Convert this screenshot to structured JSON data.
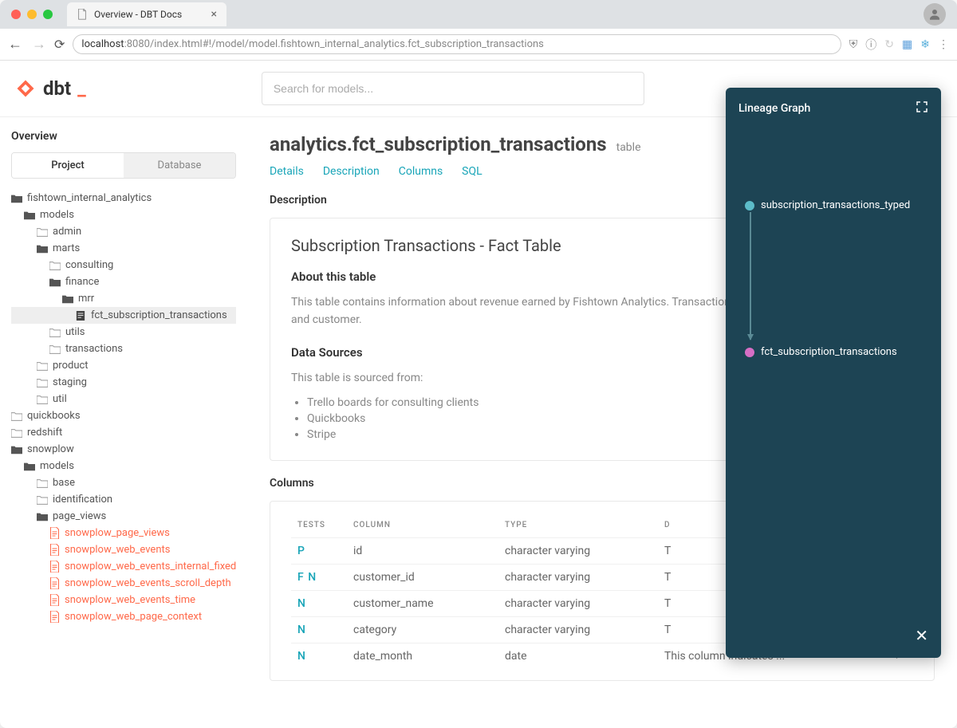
{
  "browser": {
    "tab_title": "Overview - DBT Docs",
    "url_host": "localhost",
    "url_port": ":8080",
    "url_path": "/index.html#!/model/model.fishtown_internal_analytics.fct_subscription_transactions"
  },
  "header": {
    "brand": "dbt",
    "search_placeholder": "Search for models..."
  },
  "sidebar": {
    "overview_label": "Overview",
    "tabs": {
      "project": "Project",
      "database": "Database"
    },
    "tree": [
      {
        "indent": 0,
        "icon": "folder",
        "label": "fishtown_internal_analytics",
        "open": true
      },
      {
        "indent": 1,
        "icon": "folder",
        "label": "models",
        "open": true
      },
      {
        "indent": 2,
        "icon": "folder-o",
        "label": "admin"
      },
      {
        "indent": 2,
        "icon": "folder",
        "label": "marts",
        "open": true
      },
      {
        "indent": 3,
        "icon": "folder-o",
        "label": "consulting"
      },
      {
        "indent": 3,
        "icon": "folder",
        "label": "finance",
        "open": true
      },
      {
        "indent": 4,
        "icon": "folder",
        "label": "mrr",
        "open": true
      },
      {
        "indent": 5,
        "icon": "file",
        "label": "fct_subscription_transactions",
        "selected": true
      },
      {
        "indent": 3,
        "icon": "folder-o",
        "label": "utils"
      },
      {
        "indent": 3,
        "icon": "folder-o",
        "label": "transactions"
      },
      {
        "indent": 2,
        "icon": "folder-o",
        "label": "product"
      },
      {
        "indent": 2,
        "icon": "folder-o",
        "label": "staging"
      },
      {
        "indent": 2,
        "icon": "folder-o",
        "label": "util"
      },
      {
        "indent": 0,
        "icon": "folder-o",
        "label": "quickbooks"
      },
      {
        "indent": 0,
        "icon": "folder-o",
        "label": "redshift"
      },
      {
        "indent": 0,
        "icon": "folder",
        "label": "snowplow",
        "open": true
      },
      {
        "indent": 1,
        "icon": "folder",
        "label": "models",
        "open": true
      },
      {
        "indent": 2,
        "icon": "folder-o",
        "label": "base"
      },
      {
        "indent": 2,
        "icon": "folder-o",
        "label": "identification"
      },
      {
        "indent": 2,
        "icon": "folder",
        "label": "page_views",
        "open": true
      },
      {
        "indent": 3,
        "icon": "doc",
        "label": "snowplow_page_views",
        "orange": true
      },
      {
        "indent": 3,
        "icon": "doc",
        "label": "snowplow_web_events",
        "orange": true
      },
      {
        "indent": 3,
        "icon": "doc",
        "label": "snowplow_web_events_internal_fixed",
        "orange": true
      },
      {
        "indent": 3,
        "icon": "doc",
        "label": "snowplow_web_events_scroll_depth",
        "orange": true
      },
      {
        "indent": 3,
        "icon": "doc",
        "label": "snowplow_web_events_time",
        "orange": true
      },
      {
        "indent": 3,
        "icon": "doc",
        "label": "snowplow_web_page_context",
        "orange": true
      }
    ]
  },
  "main": {
    "title": "analytics.fct_subscription_transactions",
    "title_type": "table",
    "section_tabs": [
      "Details",
      "Description",
      "Columns",
      "SQL"
    ],
    "description": {
      "header": "Description",
      "card_title": "Subscription Transactions - Fact Table",
      "about_heading": "About this table",
      "about_text": "This table contains information about revenue earned by Fishtown Analytics. Transactions are grouped by month, category, and customer.",
      "sources_heading": "Data Sources",
      "sources_intro": "This table is sourced from:",
      "sources_list": [
        "Trello boards for consulting clients",
        "Quickbooks",
        "Stripe"
      ]
    },
    "columns": {
      "header": "Columns",
      "th_tests": "TESTS",
      "th_column": "COLUMN",
      "th_type": "TYPE",
      "th_desc": "D",
      "rows": [
        {
          "tests": "P",
          "column": "id",
          "type": "character varying",
          "desc": "T"
        },
        {
          "tests": "F N",
          "column": "customer_id",
          "type": "character varying",
          "desc": "T"
        },
        {
          "tests": "N",
          "column": "customer_name",
          "type": "character varying",
          "desc": "T"
        },
        {
          "tests": "N",
          "column": "category",
          "type": "character varying",
          "desc": "T"
        },
        {
          "tests": "N",
          "column": "date_month",
          "type": "date",
          "desc": "This column indicates ..."
        }
      ]
    }
  },
  "lineage": {
    "title": "Lineage Graph",
    "node1": "subscription_transactions_typed",
    "node2": "fct_subscription_transactions"
  }
}
